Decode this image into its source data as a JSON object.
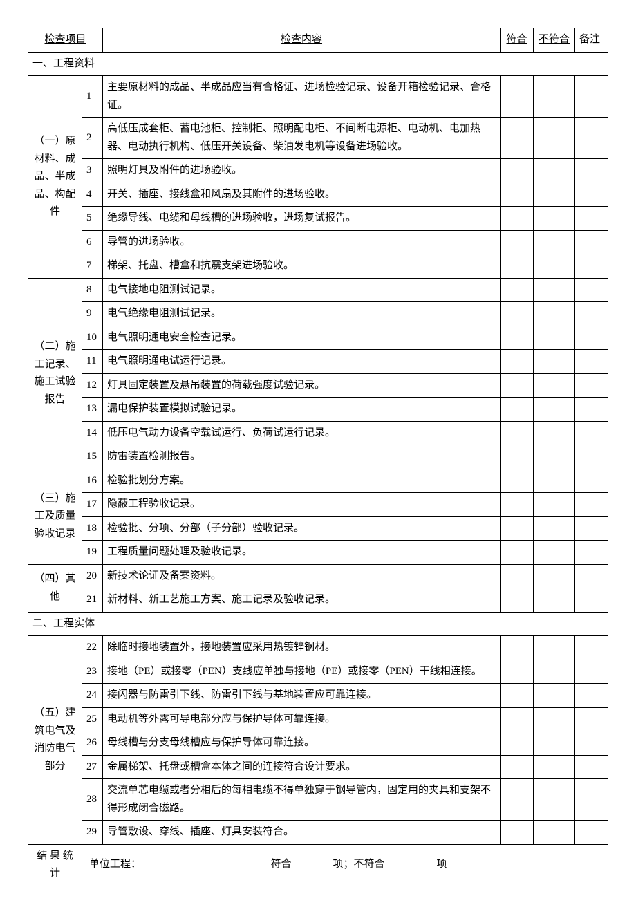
{
  "headers": {
    "item": "检查项目",
    "content": "检查内容",
    "conform": "符合",
    "nonconform": "不符合",
    "remark": "备注"
  },
  "sections": {
    "s1": "一、工程资料",
    "s2": "二、工程实体"
  },
  "groups": {
    "g1": "（一）原材料、成品、半成品、构配件",
    "g2": "（二）施工记录、施工试验报告",
    "g3": "（三）施工及质量验收记录",
    "g4": "（四）其他",
    "g5": "（五）建筑电气及消防电气部分"
  },
  "rows": {
    "r1": {
      "n": "1",
      "c": "主要原材料的成品、半成品应当有合格证、进场检验记录、设备开箱检验记录、合格证。"
    },
    "r2": {
      "n": "2",
      "c": "高低压成套柜、蓄电池柜、控制柜、照明配电柜、不间断电源柜、电动机、电加热器、电动执行机构、低压开关设备、柴油发电机等设备进场验收。"
    },
    "r3": {
      "n": "3",
      "c": "照明灯具及附件的进场验收。"
    },
    "r4": {
      "n": "4",
      "c": "开关、插座、接线盒和风扇及其附件的进场验收。"
    },
    "r5": {
      "n": "5",
      "c": "绝缘导线、电缆和母线槽的进场验收，进场复试报告。"
    },
    "r6": {
      "n": "6",
      "c": "导管的进场验收。"
    },
    "r7": {
      "n": "7",
      "c": "梯架、托盘、槽盒和抗震支架进场验收。"
    },
    "r8": {
      "n": "8",
      "c": "电气接地电阻测试记录。"
    },
    "r9": {
      "n": "9",
      "c": "电气绝缘电阻测试记录。"
    },
    "r10": {
      "n": "10",
      "c": "电气照明通电安全检查记录。"
    },
    "r11": {
      "n": "11",
      "c": "电气照明通电试运行记录。"
    },
    "r12": {
      "n": "12",
      "c": "灯具固定装置及悬吊装置的荷载强度试验记录。"
    },
    "r13": {
      "n": "13",
      "c": "漏电保护装置模拟试验记录。"
    },
    "r14": {
      "n": "14",
      "c": "低压电气动力设备空载试运行、负荷试运行记录。"
    },
    "r15": {
      "n": "15",
      "c": "防雷装置检测报告。"
    },
    "r16": {
      "n": "16",
      "c": "检验批划分方案。"
    },
    "r17": {
      "n": "17",
      "c": "隐蔽工程验收记录。"
    },
    "r18": {
      "n": "18",
      "c": "检验批、分项、分部（子分部）验收记录。"
    },
    "r19": {
      "n": "19",
      "c": "工程质量问题处理及验收记录。"
    },
    "r20": {
      "n": "20",
      "c": "新技术论证及备案资料。"
    },
    "r21": {
      "n": "21",
      "c": "新材料、新工艺施工方案、施工记录及验收记录。"
    },
    "r22": {
      "n": "22",
      "c": "除临时接地装置外，接地装置应采用热镀锌钢材。"
    },
    "r23": {
      "n": "23",
      "c": "接地（PE）或接零（PEN）支线应单独与接地（PE）或接零（PEN）干线相连接。"
    },
    "r24": {
      "n": "24",
      "c": "接闪器与防雷引下线、防雷引下线与基地装置应可靠连接。"
    },
    "r25": {
      "n": "25",
      "c": "电动机等外露可导电部分应与保护导体可靠连接。"
    },
    "r26": {
      "n": "26",
      "c": "母线槽与分支母线槽应与保护导体可靠连接。"
    },
    "r27": {
      "n": "27",
      "c": "金属梯架、托盘或槽盒本体之间的连接符合设计要求。"
    },
    "r28": {
      "n": "28",
      "c": "交流单芯电缆或者分相后的每相电缆不得单独穿于钢导管内，固定用的夹具和支架不得形成闭合磁路。"
    },
    "r29": {
      "n": "29",
      "c": "导管敷设、穿线、插座、灯具安装符合。"
    }
  },
  "summary": {
    "label": "结 果 统计",
    "text": "单位工程：　　　　　　　　　　　　　符合　　　　项；不符合　　　　　项"
  }
}
